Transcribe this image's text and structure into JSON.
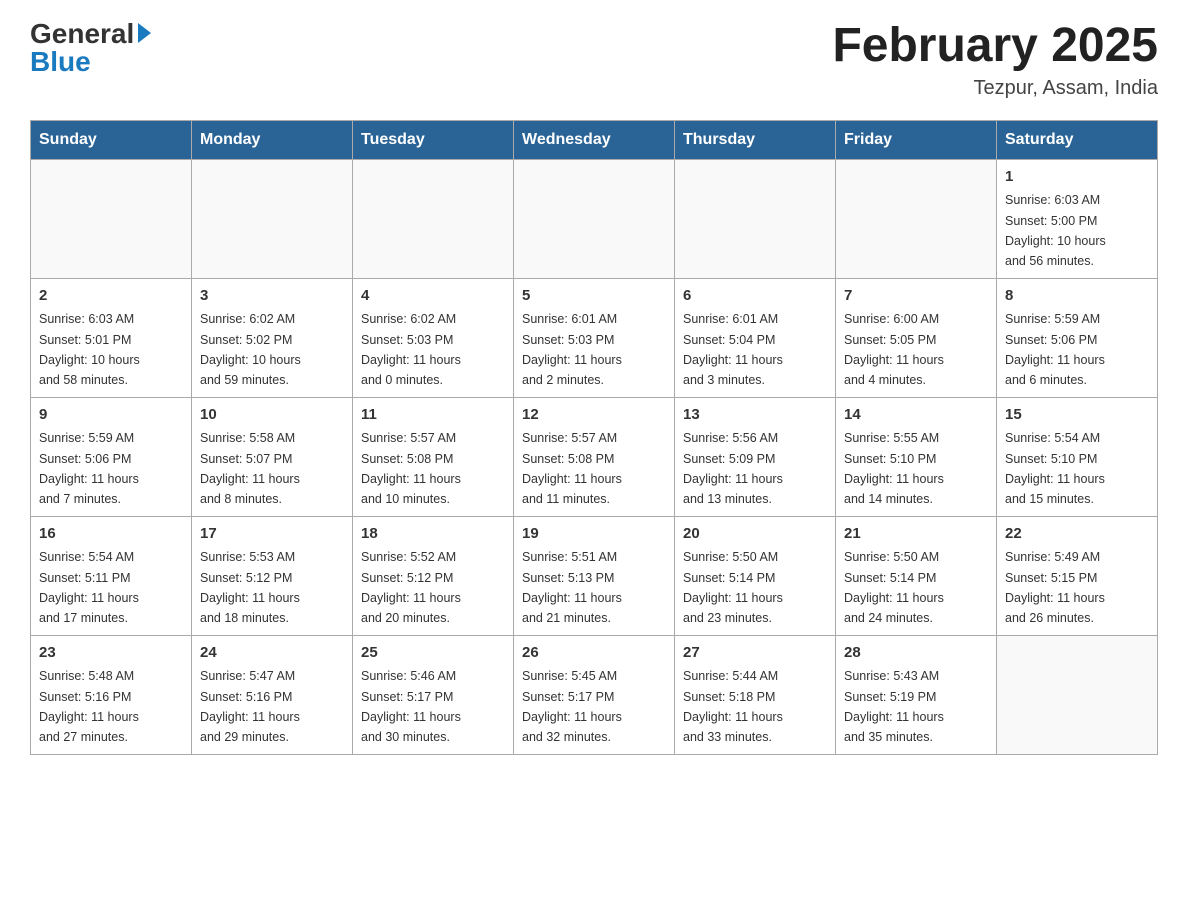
{
  "header": {
    "logo_general": "General",
    "logo_blue": "Blue",
    "month_title": "February 2025",
    "location": "Tezpur, Assam, India"
  },
  "days_of_week": [
    "Sunday",
    "Monday",
    "Tuesday",
    "Wednesday",
    "Thursday",
    "Friday",
    "Saturday"
  ],
  "weeks": [
    [
      {
        "day": "",
        "info": ""
      },
      {
        "day": "",
        "info": ""
      },
      {
        "day": "",
        "info": ""
      },
      {
        "day": "",
        "info": ""
      },
      {
        "day": "",
        "info": ""
      },
      {
        "day": "",
        "info": ""
      },
      {
        "day": "1",
        "info": "Sunrise: 6:03 AM\nSunset: 5:00 PM\nDaylight: 10 hours\nand 56 minutes."
      }
    ],
    [
      {
        "day": "2",
        "info": "Sunrise: 6:03 AM\nSunset: 5:01 PM\nDaylight: 10 hours\nand 58 minutes."
      },
      {
        "day": "3",
        "info": "Sunrise: 6:02 AM\nSunset: 5:02 PM\nDaylight: 10 hours\nand 59 minutes."
      },
      {
        "day": "4",
        "info": "Sunrise: 6:02 AM\nSunset: 5:03 PM\nDaylight: 11 hours\nand 0 minutes."
      },
      {
        "day": "5",
        "info": "Sunrise: 6:01 AM\nSunset: 5:03 PM\nDaylight: 11 hours\nand 2 minutes."
      },
      {
        "day": "6",
        "info": "Sunrise: 6:01 AM\nSunset: 5:04 PM\nDaylight: 11 hours\nand 3 minutes."
      },
      {
        "day": "7",
        "info": "Sunrise: 6:00 AM\nSunset: 5:05 PM\nDaylight: 11 hours\nand 4 minutes."
      },
      {
        "day": "8",
        "info": "Sunrise: 5:59 AM\nSunset: 5:06 PM\nDaylight: 11 hours\nand 6 minutes."
      }
    ],
    [
      {
        "day": "9",
        "info": "Sunrise: 5:59 AM\nSunset: 5:06 PM\nDaylight: 11 hours\nand 7 minutes."
      },
      {
        "day": "10",
        "info": "Sunrise: 5:58 AM\nSunset: 5:07 PM\nDaylight: 11 hours\nand 8 minutes."
      },
      {
        "day": "11",
        "info": "Sunrise: 5:57 AM\nSunset: 5:08 PM\nDaylight: 11 hours\nand 10 minutes."
      },
      {
        "day": "12",
        "info": "Sunrise: 5:57 AM\nSunset: 5:08 PM\nDaylight: 11 hours\nand 11 minutes."
      },
      {
        "day": "13",
        "info": "Sunrise: 5:56 AM\nSunset: 5:09 PM\nDaylight: 11 hours\nand 13 minutes."
      },
      {
        "day": "14",
        "info": "Sunrise: 5:55 AM\nSunset: 5:10 PM\nDaylight: 11 hours\nand 14 minutes."
      },
      {
        "day": "15",
        "info": "Sunrise: 5:54 AM\nSunset: 5:10 PM\nDaylight: 11 hours\nand 15 minutes."
      }
    ],
    [
      {
        "day": "16",
        "info": "Sunrise: 5:54 AM\nSunset: 5:11 PM\nDaylight: 11 hours\nand 17 minutes."
      },
      {
        "day": "17",
        "info": "Sunrise: 5:53 AM\nSunset: 5:12 PM\nDaylight: 11 hours\nand 18 minutes."
      },
      {
        "day": "18",
        "info": "Sunrise: 5:52 AM\nSunset: 5:12 PM\nDaylight: 11 hours\nand 20 minutes."
      },
      {
        "day": "19",
        "info": "Sunrise: 5:51 AM\nSunset: 5:13 PM\nDaylight: 11 hours\nand 21 minutes."
      },
      {
        "day": "20",
        "info": "Sunrise: 5:50 AM\nSunset: 5:14 PM\nDaylight: 11 hours\nand 23 minutes."
      },
      {
        "day": "21",
        "info": "Sunrise: 5:50 AM\nSunset: 5:14 PM\nDaylight: 11 hours\nand 24 minutes."
      },
      {
        "day": "22",
        "info": "Sunrise: 5:49 AM\nSunset: 5:15 PM\nDaylight: 11 hours\nand 26 minutes."
      }
    ],
    [
      {
        "day": "23",
        "info": "Sunrise: 5:48 AM\nSunset: 5:16 PM\nDaylight: 11 hours\nand 27 minutes."
      },
      {
        "day": "24",
        "info": "Sunrise: 5:47 AM\nSunset: 5:16 PM\nDaylight: 11 hours\nand 29 minutes."
      },
      {
        "day": "25",
        "info": "Sunrise: 5:46 AM\nSunset: 5:17 PM\nDaylight: 11 hours\nand 30 minutes."
      },
      {
        "day": "26",
        "info": "Sunrise: 5:45 AM\nSunset: 5:17 PM\nDaylight: 11 hours\nand 32 minutes."
      },
      {
        "day": "27",
        "info": "Sunrise: 5:44 AM\nSunset: 5:18 PM\nDaylight: 11 hours\nand 33 minutes."
      },
      {
        "day": "28",
        "info": "Sunrise: 5:43 AM\nSunset: 5:19 PM\nDaylight: 11 hours\nand 35 minutes."
      },
      {
        "day": "",
        "info": ""
      }
    ]
  ]
}
